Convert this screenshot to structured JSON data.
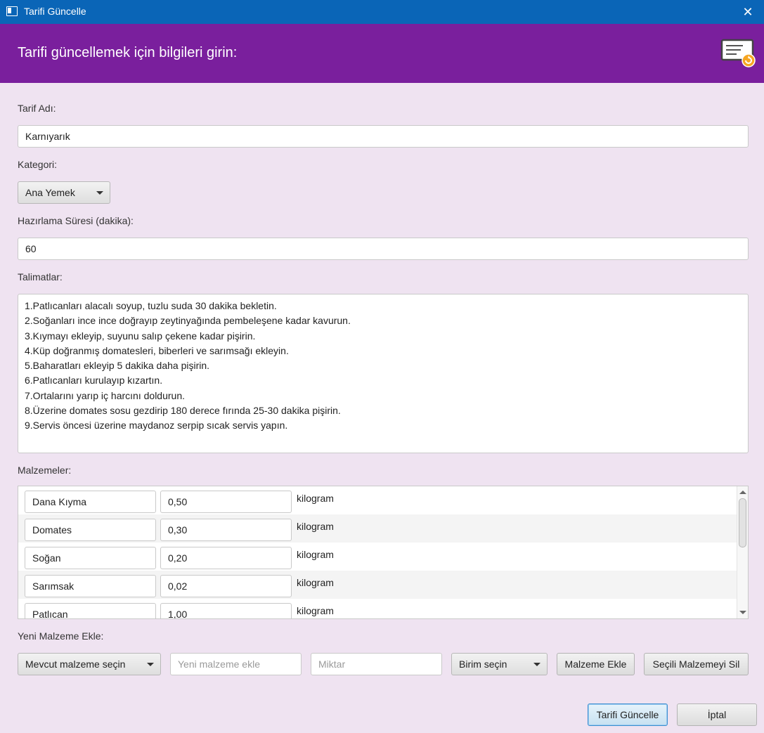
{
  "window": {
    "title": "Tarifi Güncelle",
    "close_glyph": "✕"
  },
  "header": {
    "heading": "Tarifi güncellemek için bilgileri girin:",
    "icon": "document-edit-icon"
  },
  "form": {
    "name_label": "Tarif Adı:",
    "name_value": "Karnıyarık",
    "category_label": "Kategori:",
    "category_value": "Ana Yemek",
    "prep_label": "Hazırlama Süresi (dakika):",
    "prep_value": "60",
    "instructions_label": "Talimatlar:",
    "instructions": [
      "1.Patlıcanları alacalı soyup, tuzlu suda 30 dakika bekletin.",
      "2.Soğanları ince ince doğrayıp zeytinyağında pembeleşene kadar kavurun.",
      "3.Kıymayı ekleyip, suyunu salıp çekene kadar pişirin.",
      "4.Küp doğranmış domatesleri, biberleri ve sarımsağı ekleyin.",
      "5.Baharatları ekleyip 5 dakika daha pişirin.",
      "6.Patlıcanları kurulayıp kızartın.",
      "7.Ortalarını yarıp iç harcını doldurun.",
      "8.Üzerine domates sosu gezdirip 180 derece fırında 25-30 dakika pişirin.",
      "9.Servis öncesi üzerine maydanoz serpip sıcak servis yapın."
    ],
    "ingredients_label": "Malzemeler:",
    "ingredients": [
      {
        "name": "Dana Kıyma",
        "amount": "0,50",
        "unit": "kilogram"
      },
      {
        "name": "Domates",
        "amount": "0,30",
        "unit": "kilogram"
      },
      {
        "name": "Soğan",
        "amount": "0,20",
        "unit": "kilogram"
      },
      {
        "name": "Sarımsak",
        "amount": "0,02",
        "unit": "kilogram"
      },
      {
        "name": "Patlıcan",
        "amount": "1,00",
        "unit": "kilogram"
      }
    ],
    "new_ingredient_label": "Yeni Malzeme Ekle:",
    "existing_select": "Mevcut malzeme seçin",
    "new_name_placeholder": "Yeni malzeme ekle",
    "amount_placeholder": "Miktar",
    "unit_select": "Birim seçin",
    "add_button": "Malzeme Ekle",
    "delete_button": "Seçili Malzemeyi Sil"
  },
  "footer": {
    "update_button": "Tarifi Güncelle",
    "cancel_button": "İptal"
  },
  "colors": {
    "titlebar": "#0a65b7",
    "header": "#7a1f9d",
    "background": "#efe3f1"
  }
}
